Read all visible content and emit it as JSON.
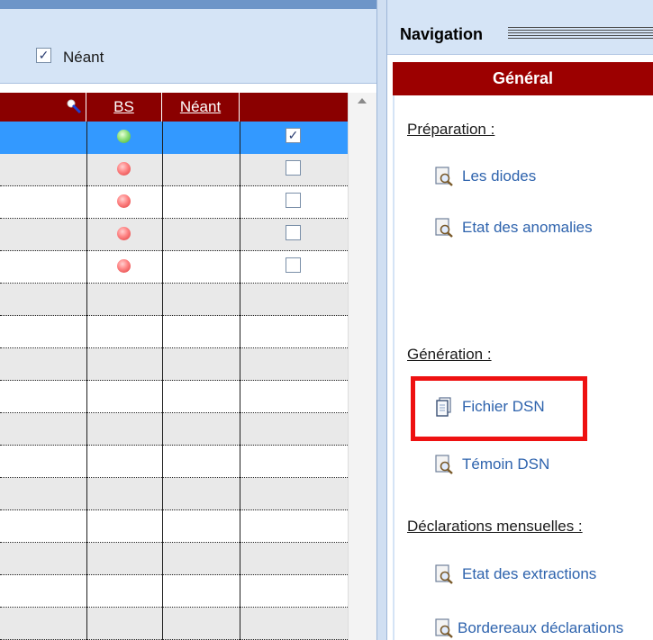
{
  "filter": {
    "checkbox_checked": true,
    "checkbox_mark": "✓",
    "label": "Néant"
  },
  "grid": {
    "columns": {
      "col1": "",
      "bs": "BS",
      "neant": "Néant",
      "check": "✓"
    },
    "rows": [
      {
        "status": "green",
        "checked": true,
        "mark": "✓",
        "selected": true
      },
      {
        "status": "red",
        "checked": false,
        "mark": ""
      },
      {
        "status": "red",
        "checked": false,
        "mark": ""
      },
      {
        "status": "red",
        "checked": false,
        "mark": ""
      },
      {
        "status": "red",
        "checked": false,
        "mark": ""
      }
    ]
  },
  "navigation": {
    "title": "Navigation",
    "tab": "Général",
    "sections": {
      "preparation": "Préparation :",
      "generation": "Génération :",
      "monthly": "Déclarations mensuelles :"
    },
    "links": {
      "diodes": "Les diodes",
      "anomalies": "Etat des anomalies",
      "fichier_dsn": "Fichier DSN",
      "temoin_dsn": "Témoin DSN",
      "extractions": "Etat des extractions",
      "bordereaux": "Bordereaux déclarations"
    }
  },
  "colors": {
    "header": "#8a0000",
    "selection": "#3399ff",
    "tab": "#9c0000",
    "link": "#2e63ad",
    "highlight": "#ee1111"
  }
}
